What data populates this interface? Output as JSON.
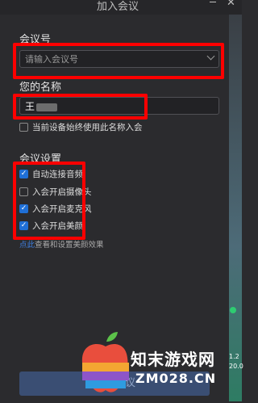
{
  "window": {
    "title": "加入会议",
    "minimize_icon": "minimize-icon",
    "close_icon": "close-icon"
  },
  "meeting_id": {
    "label": "会议号",
    "placeholder": "请输入会议号",
    "dropdown_icon": "chevron-down-icon"
  },
  "display_name": {
    "label": "您的名称",
    "value": "王"
  },
  "remember_name": {
    "label": "当前设备始终使用此名称入会",
    "checked": false
  },
  "settings": {
    "label": "会议设置",
    "options": [
      {
        "label": "自动连接音频",
        "checked": true
      },
      {
        "label": "入会开启摄像头",
        "checked": false
      },
      {
        "label": "入会开启麦克风",
        "checked": true
      },
      {
        "label": "入会开启美颜",
        "checked": true
      }
    ],
    "beauty_link": {
      "link_text": "点此",
      "rest_text": "查看和设置美颜效果"
    }
  },
  "join_button": {
    "label": "加入会议"
  },
  "side_panel": {
    "values": [
      "1.2",
      "20.0"
    ]
  },
  "watermark": {
    "text_cn": "知末游戏网",
    "text_en": "ZM028.CN"
  },
  "colors": {
    "accent": "#1f6fd6",
    "highlight_box": "#ff0000",
    "background": "#2b2b2e"
  }
}
